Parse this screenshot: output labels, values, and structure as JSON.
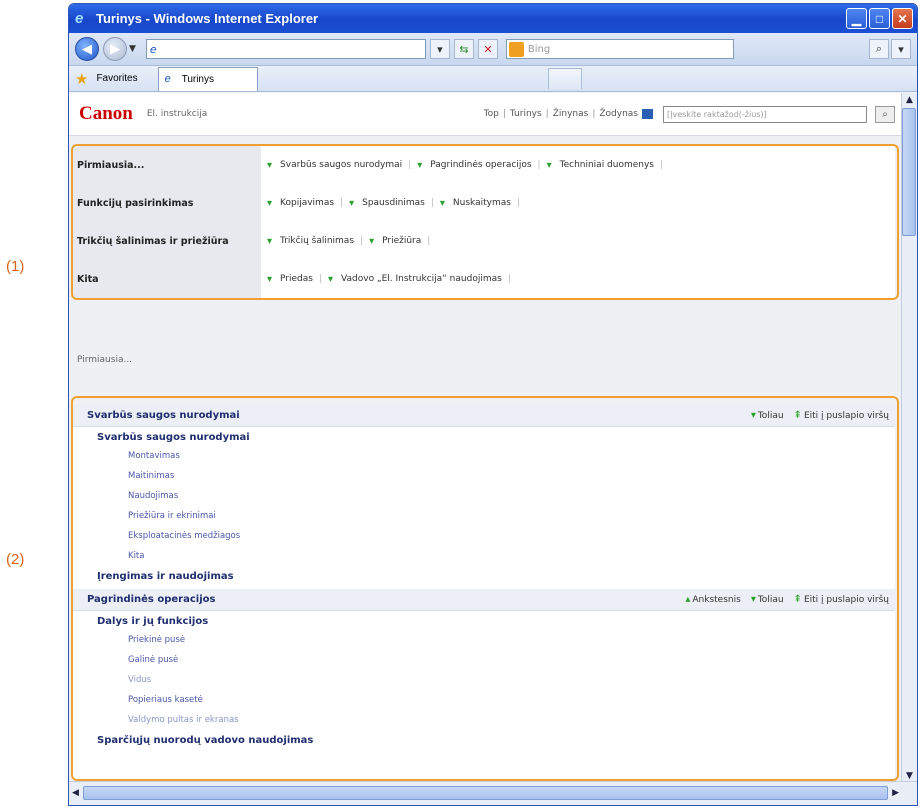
{
  "callouts": [
    "(1)",
    "(2)"
  ],
  "window": {
    "title": "Turinys - Windows Internet Explorer"
  },
  "toolbar": {
    "address_value": "",
    "search_placeholder": "Bing"
  },
  "favorites": {
    "label": "Favorites",
    "tab_label": "Turinys"
  },
  "header": {
    "logo": "Canon",
    "subtitle": "El. instrukcija",
    "links": [
      "Top",
      "Turinys",
      "Žinynas",
      "Žodynas"
    ],
    "search_placeholder": "[Įveskite raktažod(-žius)]"
  },
  "nav": [
    {
      "label": "Pirmiausia...",
      "links": [
        "Svarbūs saugos nurodymai",
        "Pagrindinės operacijos",
        "Techniniai duomenys"
      ]
    },
    {
      "label": "Funkcijų pasirinkimas",
      "links": [
        "Kopijavimas",
        "Spausdinimas",
        "Nuskaitymas"
      ]
    },
    {
      "label": "Trikčių šalinimas ir priežiūra",
      "links": [
        "Trikčių šalinimas",
        "Priežiūra"
      ]
    },
    {
      "label": "Kita",
      "links": [
        "Priedas",
        "Vadovo „El. Instrukcija“ naudojimas"
      ]
    }
  ],
  "section_label": "Pirmiausia...",
  "sections": [
    {
      "title": "Svarbūs saugos nurodymai",
      "controls": [
        "Toliau",
        "Eiti į puslapio viršų"
      ],
      "groups": [
        {
          "title": "Svarbūs saugos nurodymai",
          "items": [
            "Montavimas",
            "Maitinimas",
            "Naudojimas",
            "Priežiūra ir ekrinimai",
            "Eksploatacinės medžiagos",
            "Kita"
          ]
        },
        {
          "title": "Įrengimas ir naudojimas",
          "items": []
        }
      ]
    },
    {
      "title": "Pagrindinės operacijos",
      "controls": [
        "Ankstesnis",
        "Toliau",
        "Eiti į puslapio viršų"
      ],
      "groups": [
        {
          "title": "Dalys ir jų funkcijos",
          "items": [
            "Priekinė pusė",
            "Galinė pusė",
            "Vidus",
            "Popieriaus kasetė",
            "Valdymo pultas ir ekranas"
          ]
        },
        {
          "title": "Sparčiųjų nuorodų vadovo naudojimas",
          "items": []
        }
      ]
    }
  ],
  "colors": {
    "accent": "#f0a030",
    "logo": "#cc0000",
    "link": "#1f2e6e"
  }
}
